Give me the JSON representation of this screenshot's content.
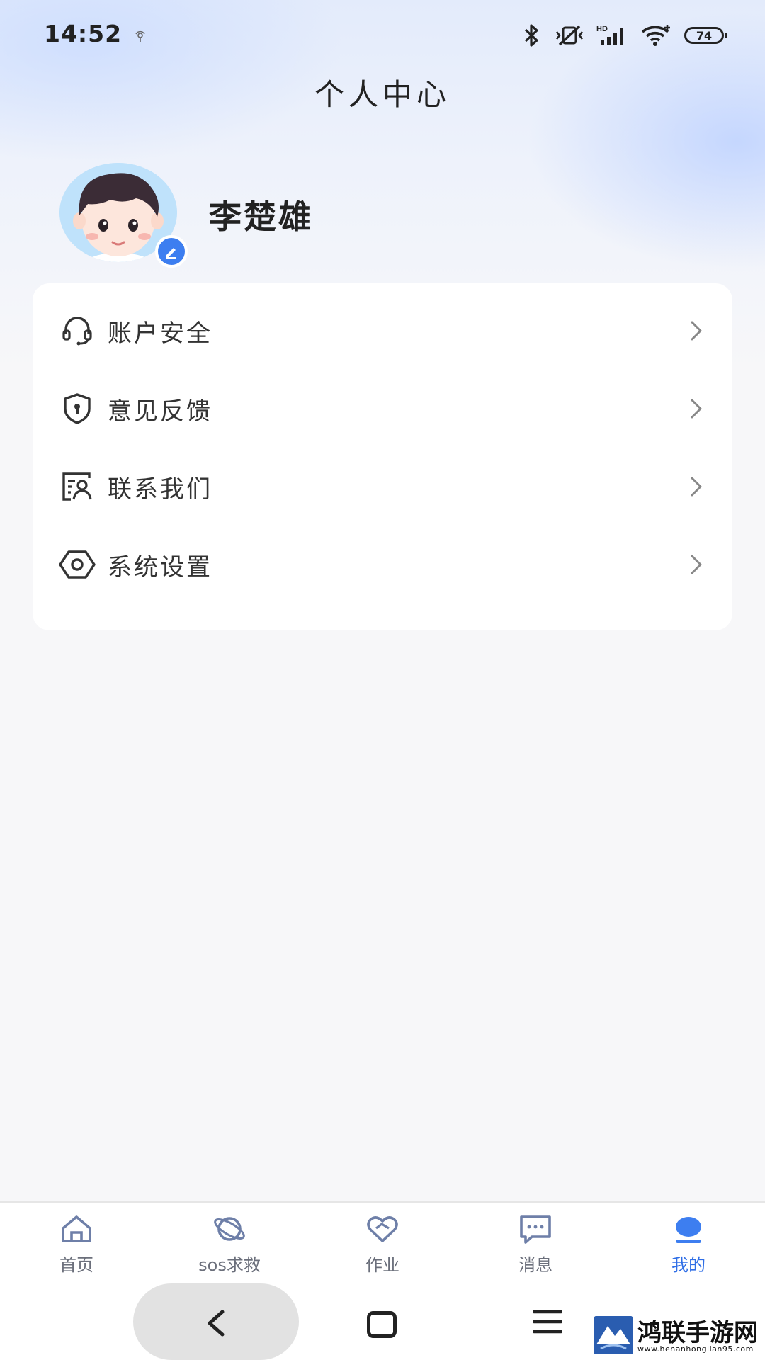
{
  "status_bar": {
    "time": "14:52",
    "battery": "74"
  },
  "header": {
    "title": "个人中心"
  },
  "profile": {
    "name": "李楚雄"
  },
  "menu": {
    "items": [
      {
        "label": "账户安全",
        "icon": "headset-icon"
      },
      {
        "label": "意见反馈",
        "icon": "shield-icon"
      },
      {
        "label": "联系我们",
        "icon": "contact-card-icon"
      },
      {
        "label": "系统设置",
        "icon": "hexagon-settings-icon"
      }
    ]
  },
  "tab_bar": {
    "active_color": "#2f6ee6",
    "tabs": [
      {
        "label": "首页",
        "icon": "home-icon"
      },
      {
        "label": "sos求救",
        "icon": "sos-planet-icon"
      },
      {
        "label": "作业",
        "icon": "heart-link-icon"
      },
      {
        "label": "消息",
        "icon": "chat-bubble-icon"
      },
      {
        "label": "我的",
        "icon": "profile-icon",
        "active": true
      }
    ]
  },
  "watermark": {
    "title": "鸿联手游网",
    "url": "www.henanhonglian95.com"
  }
}
